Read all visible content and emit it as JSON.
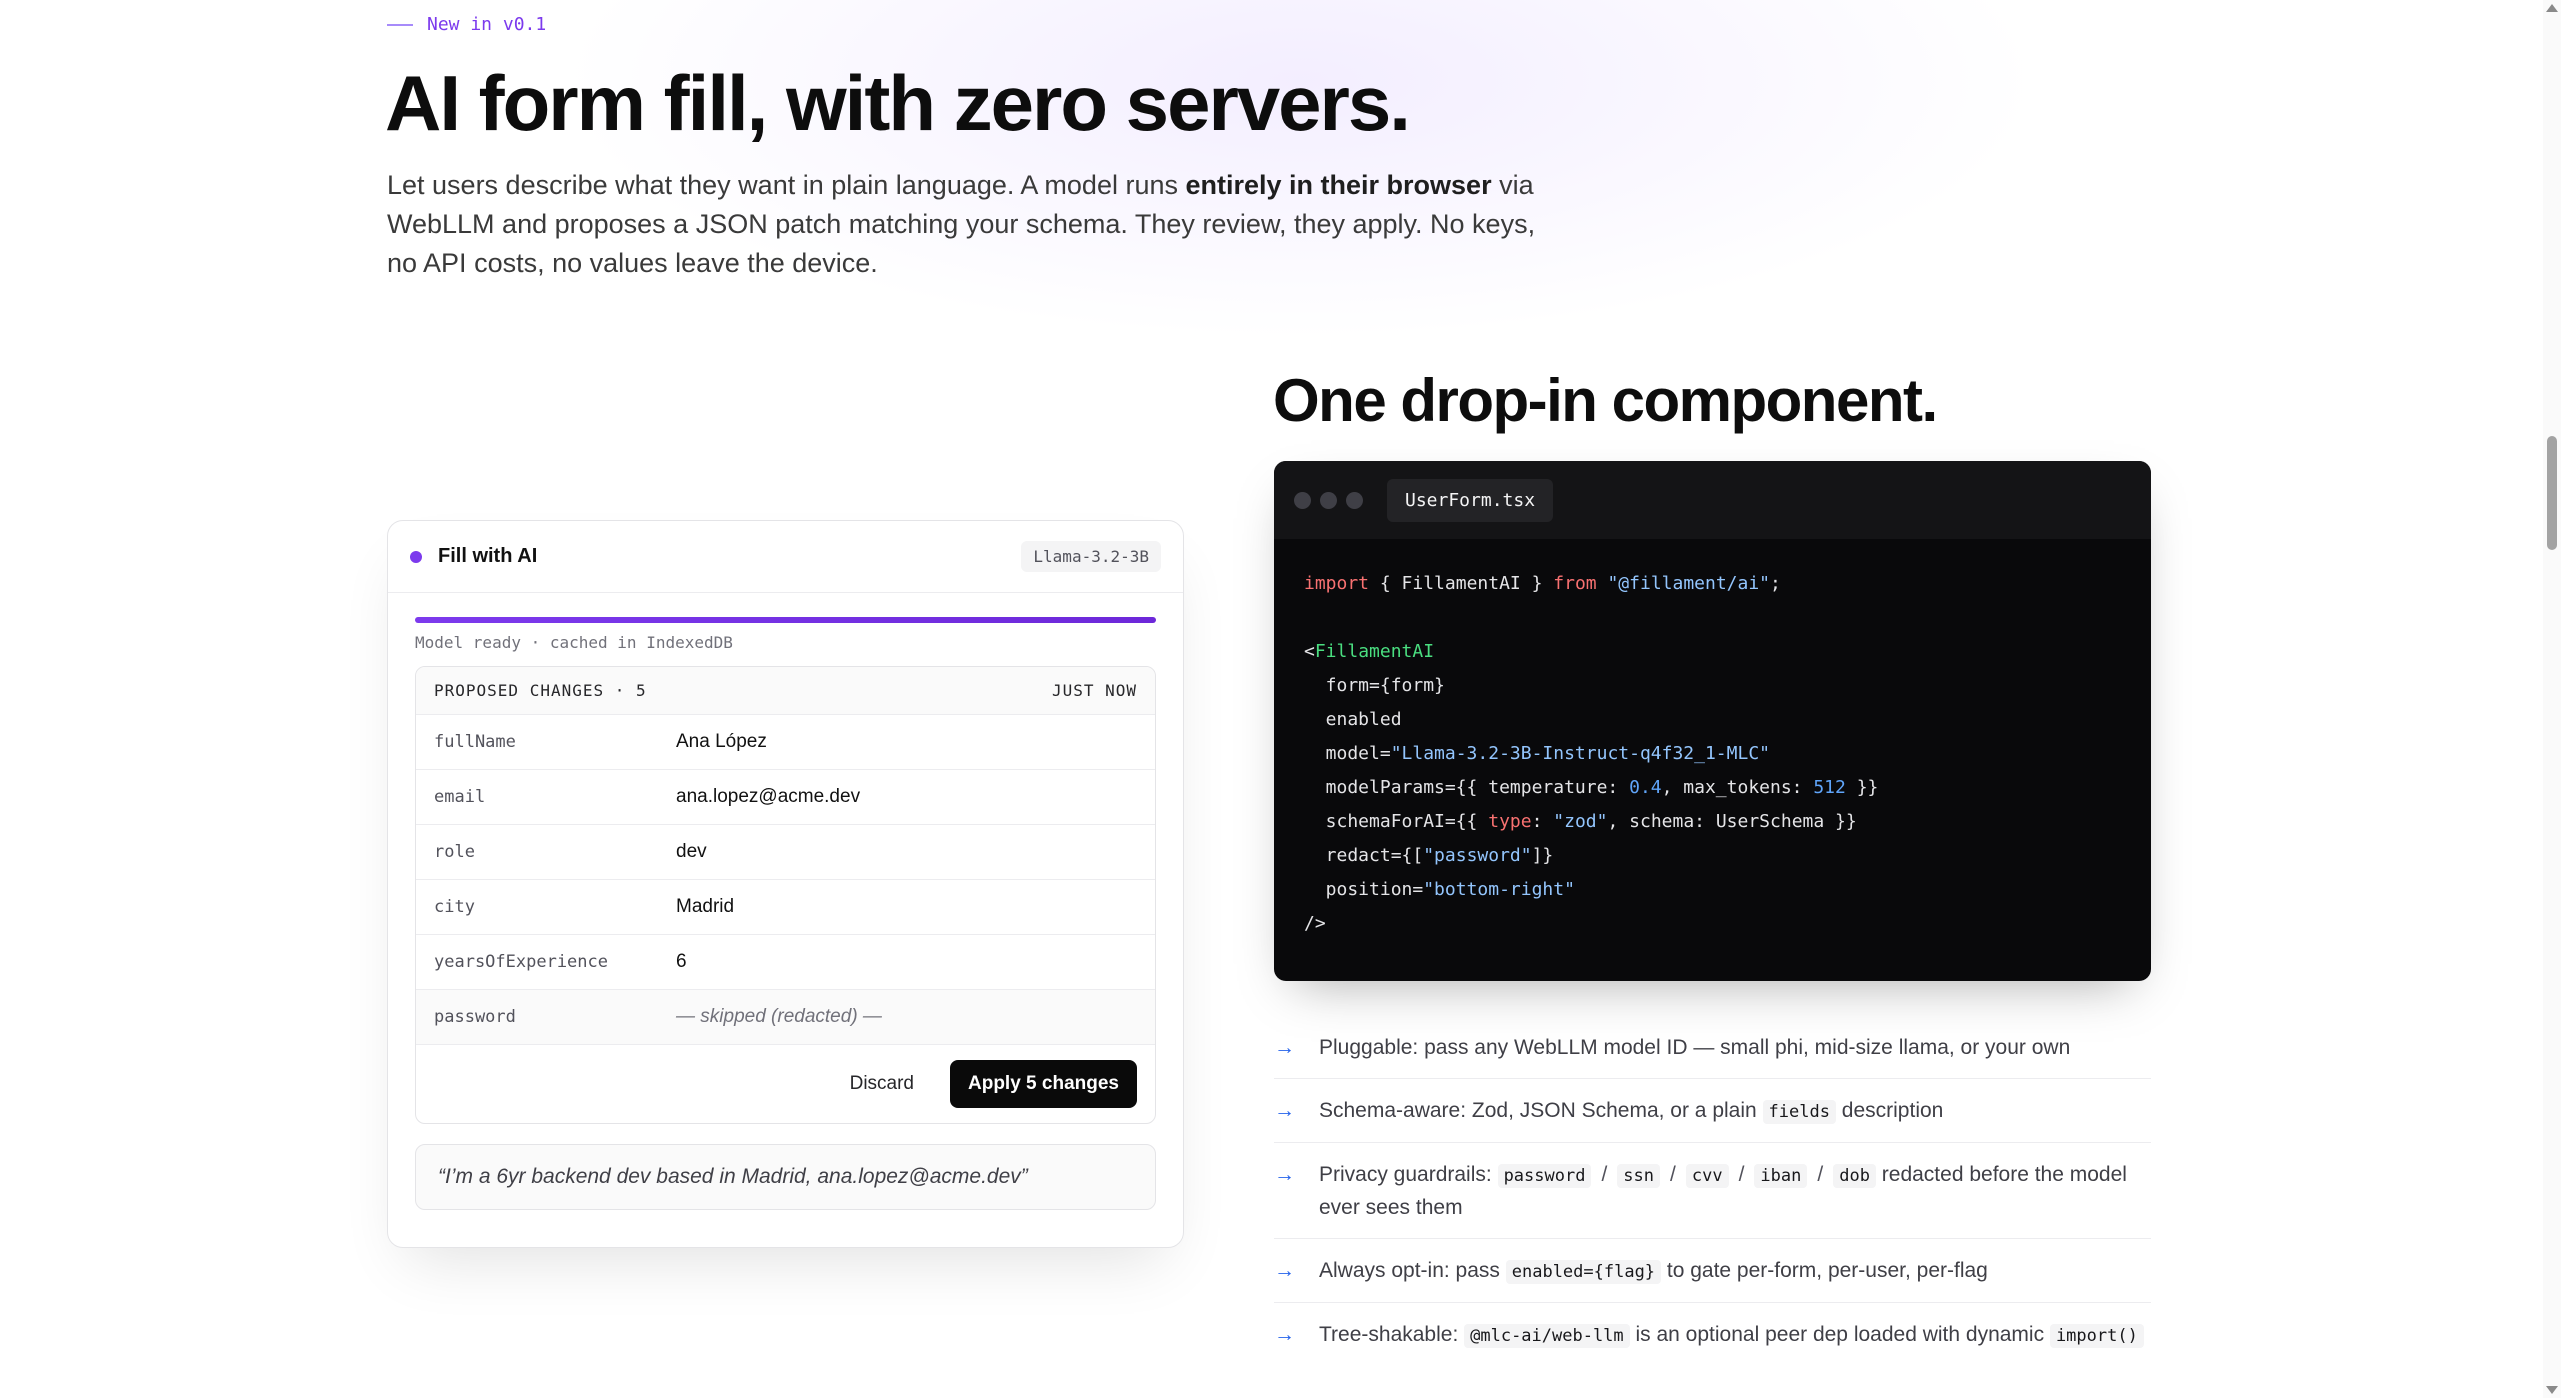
{
  "hero": {
    "eyebrow": "New in v0.1",
    "title": "AI form fill, with zero servers.",
    "lede_part1": "Let users describe what they want in plain language. A model runs ",
    "lede_bold": "entirely in their browser",
    "lede_part2": " via WebLLM and proposes a JSON patch matching your schema. They review, they apply. No keys, no API costs, no values leave the device."
  },
  "demo": {
    "title": "Fill with AI",
    "model_chip": "Llama-3.2-3B",
    "progress": 1.0,
    "status": "Model ready · cached in IndexedDB",
    "changes_label": "PROPOSED CHANGES · 5",
    "changes_time": "JUST NOW",
    "rows": [
      {
        "key": "fullName",
        "value": "Ana López"
      },
      {
        "key": "email",
        "value": "ana.lopez@acme.dev"
      },
      {
        "key": "role",
        "value": "dev"
      },
      {
        "key": "city",
        "value": "Madrid"
      },
      {
        "key": "yearsOfExperience",
        "value": "6"
      },
      {
        "key": "password",
        "value": "— skipped (redacted) —"
      }
    ],
    "discard_label": "Discard",
    "apply_label": "Apply 5 changes",
    "prompt": "“I’m a 6yr backend dev based in Madrid, ana.lopez@acme.dev”"
  },
  "section": {
    "title": "One drop-in component."
  },
  "editor": {
    "file_name": "UserForm.tsx",
    "code": {
      "import_kw": "import",
      "import_body": " { FillamentAI } ",
      "from_kw": "from",
      "import_src": "\"@fillament/ai\"",
      "semicolon": ";",
      "open_bracket": "<",
      "component": "FillamentAI",
      "prop_form": "  form={form}",
      "prop_enabled": "  enabled",
      "prop_model_key": "  model=",
      "prop_model_val": "\"Llama-3.2-3B-Instruct-q4f32_1-MLC\"",
      "prop_params_1": "  modelParams={{ temperature: ",
      "temperature": "0.4",
      "prop_params_2": ", max_tokens: ",
      "max_tokens": "512",
      "prop_params_3": " }}",
      "prop_schema_1": "  schemaForAI={{ ",
      "type_kw": "type",
      "prop_schema_2": ": ",
      "schema_type": "\"zod\"",
      "prop_schema_3": ", schema: UserSchema }}",
      "prop_redact_1": "  redact={[",
      "redact_val": "\"password\"",
      "prop_redact_2": "]}",
      "prop_position_key": "  position=",
      "prop_position_val": "\"bottom-right\"",
      "close": "/>"
    }
  },
  "features": {
    "arrow": "→",
    "f1": "Pluggable: pass any WebLLM model ID — small phi, mid-size llama, or your own",
    "f2_a": "Schema-aware: Zod, JSON Schema, or a plain ",
    "f2_code": "fields",
    "f2_b": " description",
    "f3_a": "Privacy guardrails: ",
    "f3_codes": [
      "password",
      "ssn",
      "cvv",
      "iban",
      "dob"
    ],
    "f3_sep": "/",
    "f3_b": " redacted before the model ever sees them",
    "f4_a": "Always opt-in: pass ",
    "f4_code": "enabled={flag}",
    "f4_b": " to gate per-form, per-user, per-flag",
    "f5_a": "Tree-shakable: ",
    "f5_code1": "@mlc-ai/web-llm",
    "f5_b": " is an optional peer dep loaded with dynamic ",
    "f5_code2": "import()"
  }
}
